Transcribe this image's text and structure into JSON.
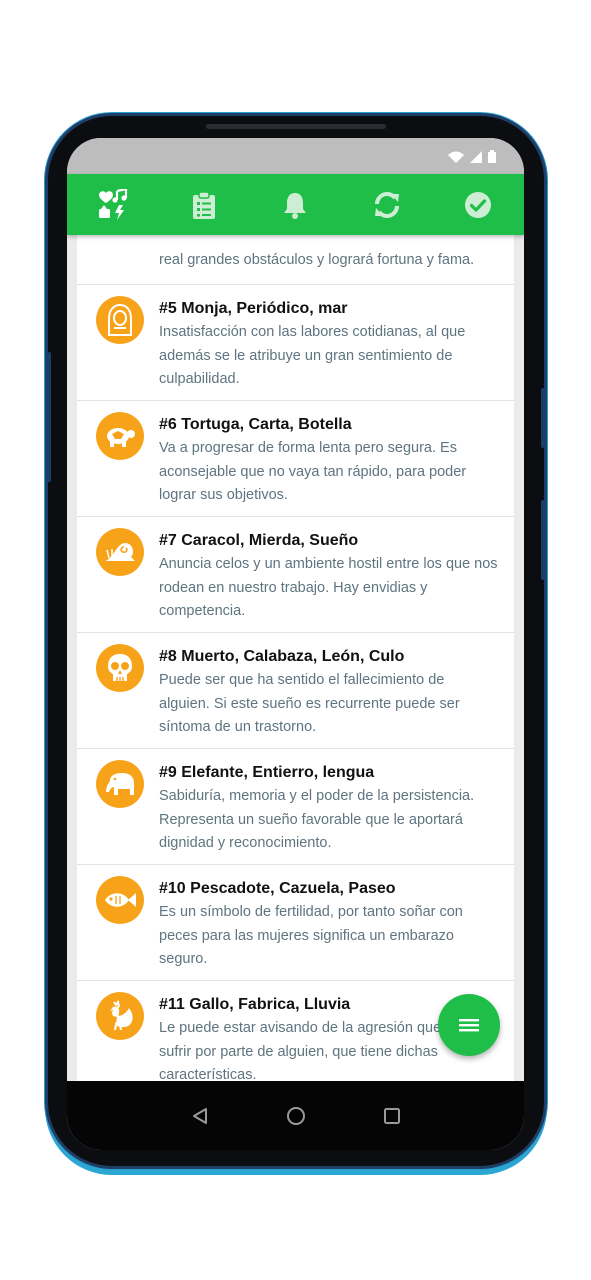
{
  "toolbar": {
    "items": [
      {
        "icon": "heart-music-icon"
      },
      {
        "icon": "clipboard-icon"
      },
      {
        "icon": "bell-icon"
      },
      {
        "icon": "sync-icon"
      },
      {
        "icon": "check-circle-icon"
      }
    ],
    "color": "#1fbe48"
  },
  "list": {
    "partial_top": {
      "desc": "real grandes obstáculos y logrará fortuna y fama."
    },
    "items": [
      {
        "title": "#5 Monja, Periódico, mar",
        "desc": "Insatisfacción con las labores cotidianas, al que además se le atribuye un gran sentimiento de culpabilidad.",
        "icon": "nun-icon"
      },
      {
        "title": "#6 Tortuga, Carta, Botella",
        "desc": "Va a progresar de forma lenta pero segura. Es aconsejable que no vaya tan rápido, para poder lograr sus objetivos.",
        "icon": "turtle-icon"
      },
      {
        "title": "#7 Caracol, Mierda, Sueño",
        "desc": "Anuncia celos y un ambiente hostil entre los que nos rodean en nuestro trabajo. Hay envidias y competencia.",
        "icon": "snail-icon"
      },
      {
        "title": "#8 Muerto, Calabaza, León, Culo",
        "desc": "Puede ser que ha sentido el fallecimiento de alguien. Si este sueño es recurrente puede ser síntoma de un trastorno.",
        "icon": "skull-icon"
      },
      {
        "title": "#9 Elefante, Entierro, lengua",
        "desc": "Sabiduría, memoria y el poder de la persistencia. Representa un sueño favorable que le aportará dignidad y reconocimiento.",
        "icon": "elephant-icon"
      },
      {
        "title": "#10 Pescadote, Cazuela, Paseo",
        "desc": "Es un símbolo de fertilidad, por tanto soñar con peces para las mujeres significa un embarazo seguro.",
        "icon": "fish-icon"
      },
      {
        "title": "#11 Gallo, Fabrica, Lluvia",
        "desc": "Le puede estar avisando de la agresión que va a sufrir por parte de alguien, que tiene dichas características.",
        "icon": "rooster-icon"
      }
    ],
    "avatar_color": "#f7a31a"
  },
  "fab": {
    "icon": "menu-icon"
  },
  "navigation": {
    "items": [
      {
        "icon": "back-triangle-icon"
      },
      {
        "icon": "home-circle-icon"
      },
      {
        "icon": "recents-square-icon"
      }
    ]
  }
}
